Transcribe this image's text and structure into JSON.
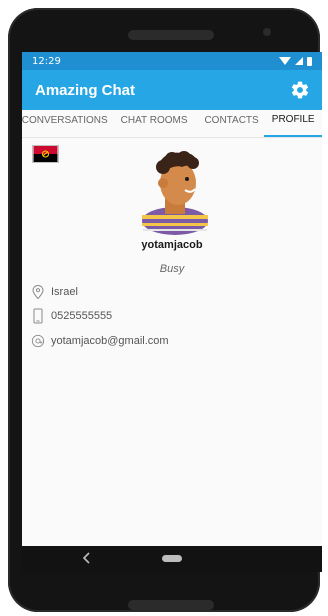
{
  "status_bar": {
    "time": "12:29"
  },
  "app_bar": {
    "title": "Amazing Chat",
    "accent_color": "#26A6E5",
    "status_color": "#1F8FD1",
    "icon": "gear-icon"
  },
  "tabs": [
    {
      "label": "CONVERSATIONS",
      "active": false
    },
    {
      "label": "CHAT ROOMS",
      "active": false
    },
    {
      "label": "CONTACTS",
      "active": false
    },
    {
      "label": "PROFILE",
      "active": true
    }
  ],
  "profile": {
    "flag_icon": "angola-flag-icon",
    "avatar": "person-avatar",
    "username": "yotamjacob",
    "status": "Busy",
    "location": "Israel",
    "phone": "0525555555",
    "email": "yotamjacob@gmail.com"
  },
  "nav_bar": {
    "back_icon": "back-chevron-icon",
    "home_icon": "home-pill-icon"
  }
}
